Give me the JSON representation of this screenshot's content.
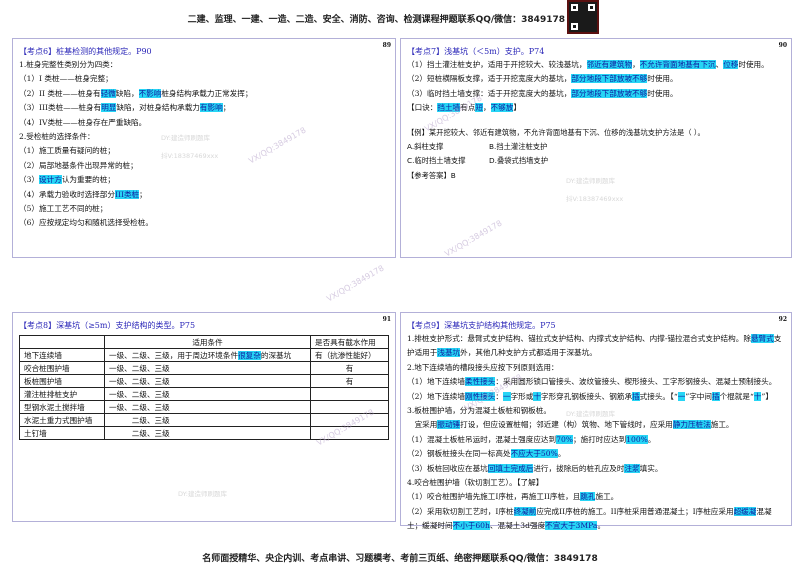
{
  "header": {
    "text": "二建、监理、一建、一造、二造、安全、消防、咨询、检测课程押题联系QQ/微信：3849178"
  },
  "footer": {
    "text": "名师面授精华、央企内训、考点串讲、习题模考、考前三页纸、绝密押题联系QQ/微信：3849178"
  },
  "watermarks": {
    "vx": "VX/QQ:3849178",
    "dy": "DY:建造师刷题库",
    "v": "抖V:18387469xxx"
  },
  "p1": {
    "page": "89",
    "title": "【考点6】桩基检测的其他规定。P90",
    "lines": [
      [
        {
          "t": "1.桩身完整性类别分为四类："
        }
      ],
      [
        {
          "t": "（1）I 类桩——桩身完整；"
        }
      ],
      [
        {
          "t": "（2）II 类桩——桩身有"
        },
        {
          "t": "轻微",
          "h": 1
        },
        {
          "t": "缺陷，"
        },
        {
          "t": "不影响",
          "h": 1
        },
        {
          "t": "桩身结构承载力正常发挥；"
        }
      ],
      [
        {
          "t": "（3）III类桩——桩身有"
        },
        {
          "t": "明显",
          "h": 1
        },
        {
          "t": "缺陷，对桩身结构承载力"
        },
        {
          "t": "有影响",
          "h": 1
        },
        {
          "t": "；"
        }
      ],
      [
        {
          "t": "（4）IV类桩——桩身存在严重缺陷。"
        }
      ],
      [
        {
          "t": "2.受检桩的选择条件："
        }
      ],
      [
        {
          "t": "（1）施工质量有疑问的桩；"
        }
      ],
      [
        {
          "t": "（2）局部地基条件出现异常的桩；"
        }
      ],
      [
        {
          "t": "（3）"
        },
        {
          "t": "设计方",
          "h": 1
        },
        {
          "t": "认为重要的桩；"
        }
      ],
      [
        {
          "t": "（4）承载力验收时选择部分"
        },
        {
          "t": "III类桩",
          "h": 1
        },
        {
          "t": "；"
        }
      ],
      [
        {
          "t": "（5）施工工艺不同的桩；"
        }
      ],
      [
        {
          "t": "（6）应按规定均匀和随机选择受检桩。"
        }
      ]
    ]
  },
  "p2": {
    "page": "90",
    "title": "【考点7】浅基坑（＜5m）支护。P74",
    "lines": [
      [
        {
          "t": "（1）挡土灌注桩支护，适用于开挖较大、较浅基坑，"
        },
        {
          "t": "邻近有建筑物",
          "h": 1
        },
        {
          "t": "，"
        },
        {
          "t": "不允许背面地基有下沉",
          "h": 1
        },
        {
          "t": "、"
        },
        {
          "t": "位移",
          "h": 1
        },
        {
          "t": "时使用。"
        }
      ],
      [
        {
          "t": "（2）短桩横隔板支撑，适于开挖宽度大的基坑，"
        },
        {
          "t": "部分地段下部放坡不够",
          "h": 1
        },
        {
          "t": "时使用。"
        }
      ],
      [
        {
          "t": "（3）临时挡土墙支撑：适于开挖宽度大的基坑，"
        },
        {
          "t": "部分地段下部放坡不够",
          "h": 1
        },
        {
          "t": "时使用。"
        }
      ],
      [
        {
          "t": "【口诀："
        },
        {
          "t": "挡土墙",
          "h": 1
        },
        {
          "t": "有点"
        },
        {
          "t": "短",
          "h": 1
        },
        {
          "t": "，"
        },
        {
          "t": "不够放",
          "h": 1
        },
        {
          "t": "】"
        }
      ]
    ],
    "example": {
      "question": "【例】某开挖较大、邻近有建筑物，不允许背面地基有下沉、位移的浅基坑支护方法是（ ）。",
      "options": [
        "A.斜柱支撑",
        "B.挡土灌注桩支护",
        "C.临时挡土墙支撑",
        "D.叠袋式挡墙支护"
      ],
      "answer": "【参考答案】B"
    }
  },
  "p3": {
    "page": "91",
    "title": "【考点8】深基坑（≥5m）支护结构的类型。P75",
    "table": {
      "headers": [
        "",
        "适用条件",
        "是否具有截水作用"
      ],
      "rows": [
        {
          "name": "地下连续墙",
          "cond": [
            {
              "t": "一级、二级、三级，用于周边环境条件"
            },
            {
              "t": "很复杂",
              "h": 1
            },
            {
              "t": "的深基坑"
            }
          ],
          "water": "有（抗渗性能好）"
        },
        {
          "name": "咬合桩围护墙",
          "cond": [
            {
              "t": "一级、二级、三级"
            }
          ],
          "water": "有"
        },
        {
          "name": "板桩围护墙",
          "cond": [
            {
              "t": "一级、二级、三级"
            }
          ],
          "water": "有"
        },
        {
          "name": "灌注桩排桩支护",
          "cond": [
            {
              "t": "一级、二级、三级"
            }
          ],
          "water": ""
        },
        {
          "name": "型钢水泥土搅拌墙",
          "cond": [
            {
              "t": "一级、二级、三级"
            }
          ],
          "water": ""
        },
        {
          "name": "水泥土重力式围护墙",
          "cond": [
            {
              "t": "　　　二级、三级"
            }
          ],
          "water": ""
        },
        {
          "name": "土钉墙",
          "cond": [
            {
              "t": "　　　二级、三级"
            }
          ],
          "water": ""
        }
      ]
    }
  },
  "p4": {
    "page": "92",
    "title": "【考点9】深基坑支护结构其他规定。P75",
    "lines": [
      [
        {
          "t": "1.排桩支护形式：悬臂式支护结构、锚拉式支护结构、内撑式支护结构、内撑-锚拉混合式支护结构。除"
        },
        {
          "t": "悬臂式",
          "h": 1
        },
        {
          "t": "支护适用于"
        },
        {
          "t": "浅基坑",
          "h": 1
        },
        {
          "t": "外，其他几种支护方式都适用于深基坑。"
        }
      ],
      [
        {
          "t": "2.地下连续墙的槽段接头应按下列原则选用："
        }
      ],
      [
        {
          "t": "（1）地下连续墙"
        },
        {
          "t": "柔性接头",
          "h": 1
        },
        {
          "t": "：采用圆形锁口管接头、波纹管接头、楔形接头、工字形钢接头、混凝土预制接头。"
        }
      ],
      [
        {
          "t": "（2）地下连续墙"
        },
        {
          "t": "刚性接头",
          "h": 1
        },
        {
          "t": "："
        },
        {
          "t": "一",
          "h": 1
        },
        {
          "t": "字形或"
        },
        {
          "t": "十",
          "h": 1
        },
        {
          "t": "字形穿孔钢板接头、钢筋承"
        },
        {
          "t": "插",
          "h": 1
        },
        {
          "t": "式接头。【“"
        },
        {
          "t": "一",
          "h": 1
        },
        {
          "t": "”字中间"
        },
        {
          "t": "插",
          "h": 1
        },
        {
          "t": "个棍就是“"
        },
        {
          "t": "十",
          "h": 1
        },
        {
          "t": "”】"
        }
      ],
      [
        {
          "t": "3.板桩围护墙，分为混凝土板桩和钢板桩。"
        }
      ],
      [
        {
          "t": "　宜采用"
        },
        {
          "t": "振动锤",
          "h": 1
        },
        {
          "t": "打设，但应设置桩帽；邻近建（构）筑物、地下管线时，应采用"
        },
        {
          "t": "静力压桩法",
          "h": 1
        },
        {
          "t": "施工。"
        }
      ],
      [
        {
          "t": "（1）混凝土板桩吊运时，混凝土强度应达到"
        },
        {
          "t": "70%",
          "h": 1
        },
        {
          "t": "；施打时应达到"
        },
        {
          "t": "100%",
          "h": 1
        },
        {
          "t": "。"
        }
      ],
      [
        {
          "t": "（2）钢板桩接头在同一标高处"
        },
        {
          "t": "不应大于50%",
          "h": 1
        },
        {
          "t": "。"
        }
      ],
      [
        {
          "t": "（3）板桩回收应在基坑"
        },
        {
          "t": "回填土完成后",
          "h": 1
        },
        {
          "t": "进行，拔除后的桩孔应及时"
        },
        {
          "t": "注浆",
          "h": 1
        },
        {
          "t": "填实。"
        }
      ],
      [
        {
          "t": "4.咬合桩围护墙（软切割工艺）。【了解】"
        }
      ],
      [
        {
          "t": "（1）咬合桩围护墙先施工I序桩，再施工II序桩，且"
        },
        {
          "t": "跳孔",
          "h": 1
        },
        {
          "t": "施工。"
        }
      ],
      [
        {
          "t": "（2）采用软切割工艺时，I序桩"
        },
        {
          "t": "终凝前",
          "h": 1
        },
        {
          "t": "应完成II序桩的施工。II序桩采用普通混凝土；I序桩应采用"
        },
        {
          "t": "超缓凝",
          "h": 1
        },
        {
          "t": "混凝土；缓凝时间"
        },
        {
          "t": "不小于60h",
          "h": 1
        },
        {
          "t": "、混凝土3d强度"
        },
        {
          "t": "不宜大于3MPa",
          "h": 1
        },
        {
          "t": "。"
        }
      ]
    ]
  }
}
